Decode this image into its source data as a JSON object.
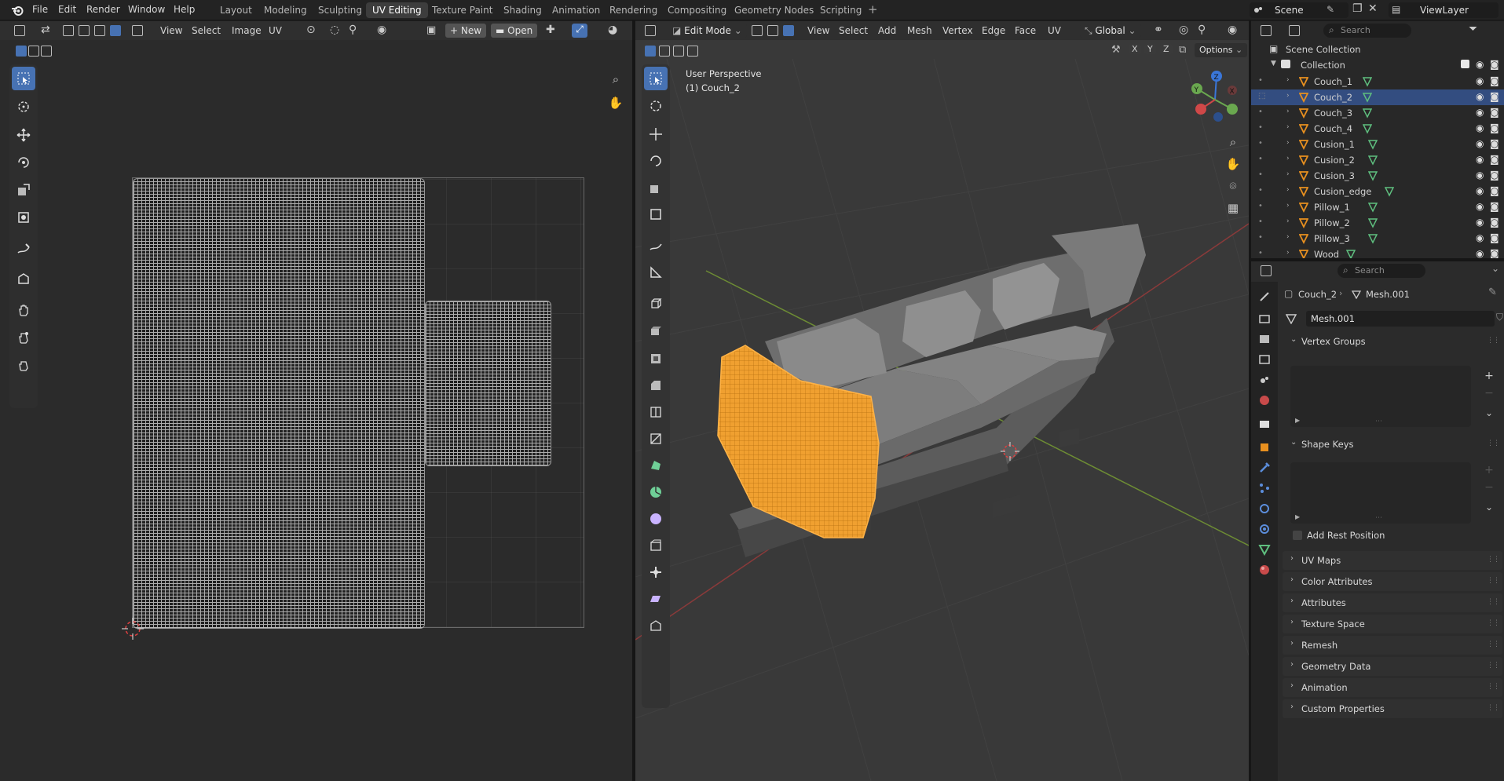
{
  "topbar": {
    "menus": [
      "File",
      "Edit",
      "Render",
      "Window",
      "Help"
    ],
    "workspaces": [
      "Layout",
      "Modeling",
      "Sculpting",
      "UV Editing",
      "Texture Paint",
      "Shading",
      "Animation",
      "Rendering",
      "Compositing",
      "Geometry Nodes",
      "Scripting"
    ],
    "active_workspace": "UV Editing",
    "scene": "Scene",
    "view_layer": "ViewLayer"
  },
  "uv_editor": {
    "header": {
      "menus": [
        "View",
        "Select",
        "Image",
        "UV"
      ],
      "new_label": "New",
      "open_label": "Open"
    }
  },
  "viewport": {
    "header": {
      "mode": "Edit Mode",
      "menus": [
        "View",
        "Select",
        "Add",
        "Mesh",
        "Vertex",
        "Edge",
        "Face",
        "UV"
      ],
      "transform_orientation": "Global",
      "options_label": "Options",
      "axis_x": "X",
      "axis_y": "Y",
      "axis_z": "Z"
    },
    "overlay": {
      "view_name": "User Perspective",
      "object_info": "(1) Couch_2"
    },
    "gizmo": {
      "x": "X",
      "y": "Y",
      "z": "Z"
    }
  },
  "outliner": {
    "search_placeholder": "Search",
    "scene_collection": "Scene Collection",
    "collection": "Collection",
    "items": [
      {
        "name": "Couch_1",
        "selected": false
      },
      {
        "name": "Couch_2",
        "selected": true
      },
      {
        "name": "Couch_3",
        "selected": false
      },
      {
        "name": "Couch_4",
        "selected": false
      },
      {
        "name": "Cusion_1",
        "selected": false
      },
      {
        "name": "Cusion_2",
        "selected": false
      },
      {
        "name": "Cusion_3",
        "selected": false
      },
      {
        "name": "Cusion_edge",
        "selected": false
      },
      {
        "name": "Pillow_1",
        "selected": false
      },
      {
        "name": "Pillow_2",
        "selected": false
      },
      {
        "name": "Pillow_3",
        "selected": false
      },
      {
        "name": "Wood",
        "selected": false
      }
    ]
  },
  "properties": {
    "search_placeholder": "Search",
    "breadcrumb_object": "Couch_2",
    "breadcrumb_data": "Mesh.001",
    "mesh_name": "Mesh.001",
    "panels": {
      "vertex_groups": "Vertex Groups",
      "shape_keys": "Shape Keys",
      "add_rest_position": "Add Rest Position",
      "uv_maps": "UV Maps",
      "color_attributes": "Color Attributes",
      "attributes": "Attributes",
      "texture_space": "Texture Space",
      "remesh": "Remesh",
      "geometry_data": "Geometry Data",
      "animation": "Animation",
      "custom_properties": "Custom Properties"
    }
  },
  "colors": {
    "accent": "#4772b3",
    "selection_orange": "#f0a030",
    "mesh_green": "#5fbf7f",
    "outliner_selected": "#334d80"
  }
}
